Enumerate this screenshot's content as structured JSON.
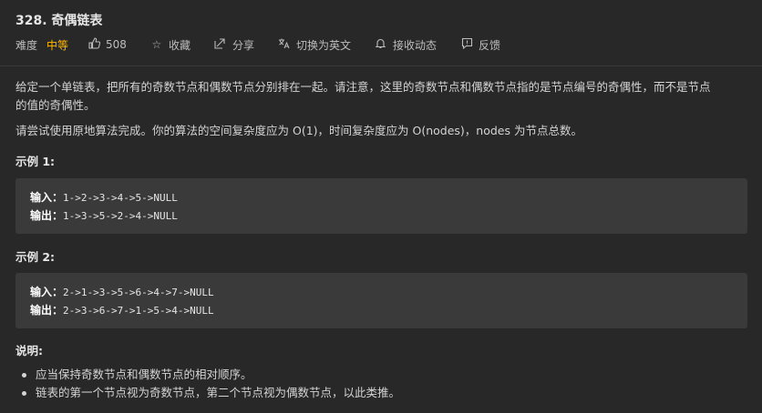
{
  "problem": {
    "title": "328. 奇偶链表"
  },
  "meta": {
    "difficulty_label": "难度",
    "difficulty_value": "中等",
    "likes": "508",
    "favorite_label": "收藏",
    "share_label": "分享",
    "switch_language_label": "切换为英文",
    "notify_label": "接收动态",
    "feedback_label": "反馈",
    "colors": {
      "difficulty": "#ffb800",
      "background": "#282828",
      "code_background": "#3a3a3a"
    },
    "icons": [
      "thumbs-up-icon",
      "star-icon",
      "share-icon",
      "translate-icon",
      "bell-icon",
      "feedback-icon"
    ]
  },
  "description": {
    "para1_line1": "给定一个单链表，把所有的奇数节点和偶数节点分别排在一起。请注意，这里的奇数节点和偶数节点指的是节点编号的奇偶性，而不是节点",
    "para1_line2": "的值的奇偶性。",
    "para2": "请尝试使用原地算法完成。你的算法的空间复杂度应为 O(1)，时间复杂度应为 O(nodes)，nodes 为节点总数。"
  },
  "examples": [
    {
      "heading": "示例 1:",
      "input_label": "输入：",
      "input": "1->2->3->4->5->NULL",
      "output_label": "输出：",
      "output": "1->3->5->2->4->NULL"
    },
    {
      "heading": "示例 2:",
      "input_label": "输入：",
      "input": "2->1->3->5->6->4->7->NULL",
      "output_label": "输出：",
      "output": "2->3->6->7->1->5->4->NULL"
    }
  ],
  "notes": {
    "heading": "说明:",
    "items": [
      "应当保持奇数节点和偶数节点的相对顺序。",
      "链表的第一个节点视为奇数节点，第二个节点视为偶数节点，以此类推。"
    ]
  }
}
